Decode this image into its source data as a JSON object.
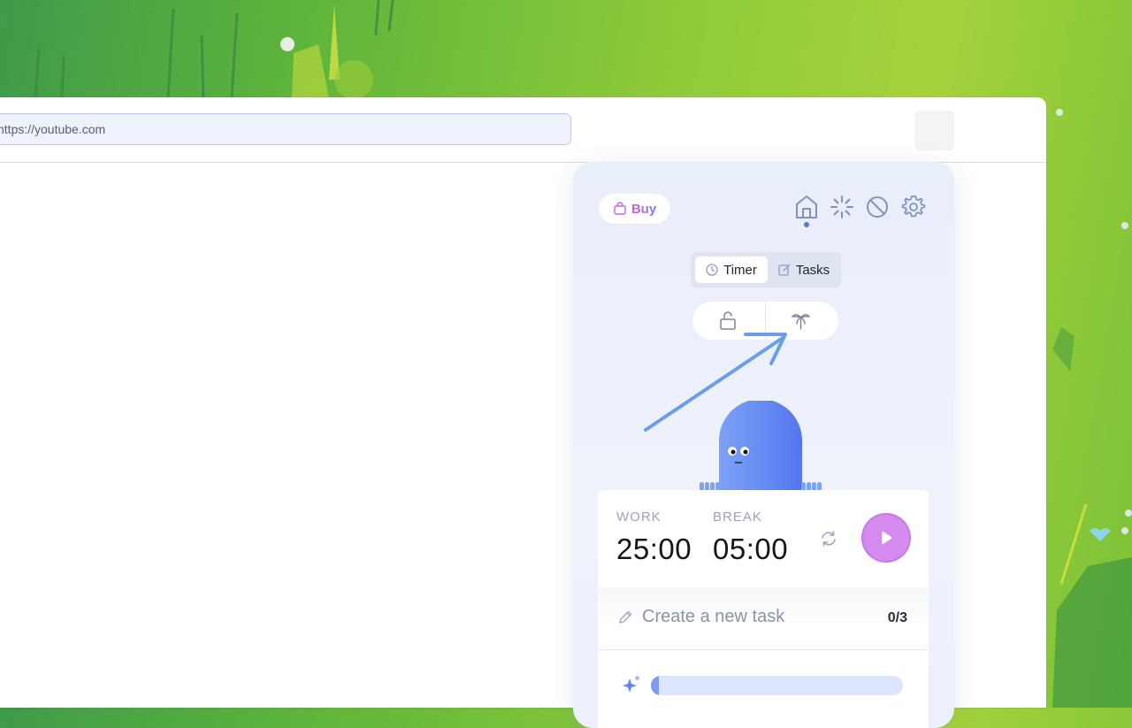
{
  "browser": {
    "url": "https://youtube.com"
  },
  "popup": {
    "buy_label": "Buy",
    "nav": {
      "active": "home",
      "icons": [
        "home-icon",
        "loading-spinner-icon",
        "blocked-icon",
        "gear-icon"
      ]
    },
    "tabs": [
      {
        "label": "Timer",
        "icon": "clock-icon",
        "active": true
      },
      {
        "label": "Tasks",
        "icon": "edit-icon",
        "active": false
      }
    ],
    "modes": [
      "lock-open-icon",
      "palm-tree-icon"
    ],
    "timer": {
      "work_label": "WORK",
      "work_value": "25:00",
      "break_label": "BREAK",
      "break_value": "05:00"
    },
    "tasks": {
      "placeholder": "Create a new task",
      "count": "0/3"
    },
    "progress": {
      "fraction": 0.03
    }
  },
  "colors": {
    "accent": "#5577e0",
    "play": "#d48aef",
    "mascot": "#6b8ef5",
    "arrow": "#6a9ee8"
  }
}
